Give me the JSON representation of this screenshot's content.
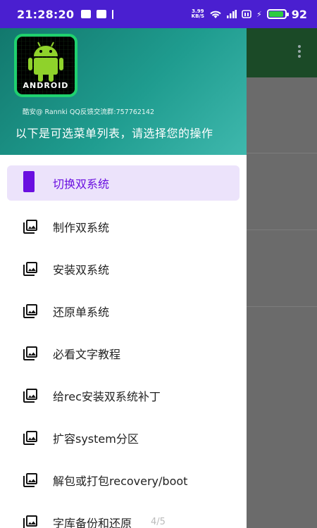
{
  "status_bar": {
    "time": "21:28:20",
    "net_speed_top": "3.99",
    "net_speed_bottom": "KB/S",
    "battery_pct": "92",
    "battery_fill": 0.92,
    "left_icons": [
      "image-notification-icon",
      "android-notification-icon",
      "usb-icon"
    ],
    "right_icons": [
      "wifi-icon",
      "signal-icon",
      "hd-icon",
      "charging-icon",
      "battery-icon"
    ]
  },
  "drawer": {
    "header": {
      "credit": "酷安@ Rannki QQ反馈交流群:757762142",
      "title": "以下是可选菜单列表，请选择您的操作",
      "logo_text": "ANDROID"
    },
    "items": [
      {
        "label": "切换双系统",
        "icon": "active-bar",
        "active": true
      },
      {
        "label": "制作双系统",
        "icon": "photo-library-icon"
      },
      {
        "label": "安装双系统",
        "icon": "photo-library-icon"
      },
      {
        "label": "还原单系统",
        "icon": "photo-library-icon"
      },
      {
        "label": "必看文字教程",
        "icon": "photo-library-icon"
      },
      {
        "label": "给rec安装双系统补丁",
        "icon": "photo-library-icon"
      },
      {
        "label": "扩容system分区",
        "icon": "photo-library-icon"
      },
      {
        "label": "解包或打包recovery/boot",
        "icon": "photo-library-icon"
      },
      {
        "label": "字库备份和还原",
        "icon": "photo-library-icon"
      }
    ]
  },
  "page_indicator": "4/5",
  "colors": {
    "status_bar": "#4a1fd0",
    "accent": "#6a0fe0",
    "active_bg": "#ece3fb",
    "header_gradient_start": "#12786d",
    "header_gradient_end": "#3fb8ad",
    "battery": "#2ecc40"
  }
}
